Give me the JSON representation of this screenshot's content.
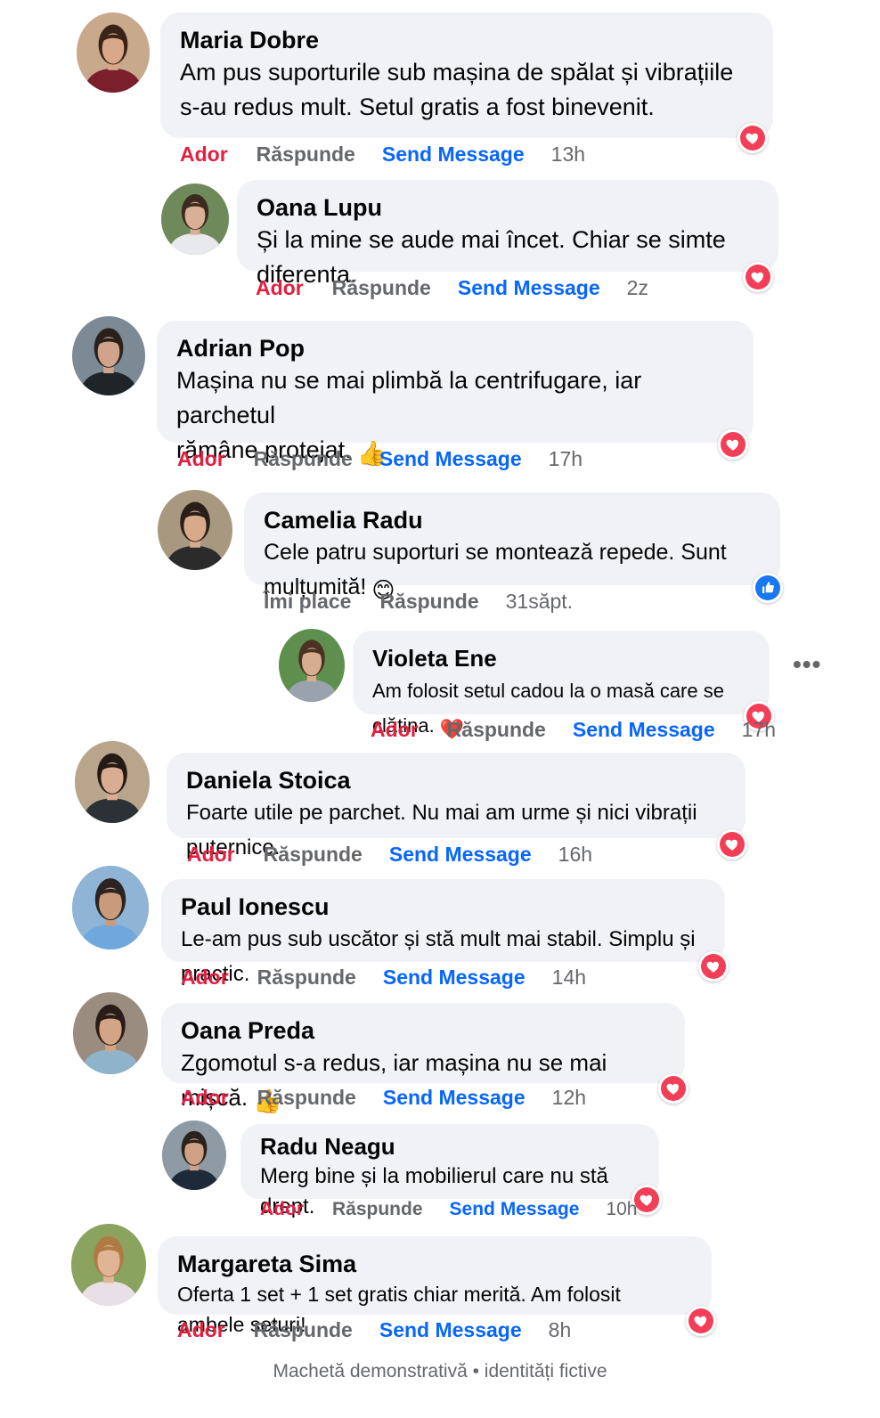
{
  "comments": [
    {
      "name": "Maria Dobre",
      "lines": [
        "Am pus suporturile sub mașina de spălat și vibrațiile",
        "s-au redus mult. Setul gratis a fost binevenit."
      ],
      "reaction_label": "Ador",
      "reply_label": "Răspunde",
      "send_label": "Send Message",
      "time": "13h",
      "reaction_icon": "love-icon",
      "avatar": {
        "bg": "#c9a98b",
        "skin": "#d9a88a",
        "hair": "#3a2418",
        "shirt": "#7a1f2b"
      }
    },
    {
      "name": "Oana Lupu",
      "lines": [
        "Și la mine se aude mai încet. Chiar se simte diferența."
      ],
      "reaction_label": "Ador",
      "reply_label": "Răspunde",
      "send_label": "Send Message",
      "time": "2z",
      "reaction_icon": "love-icon",
      "avatar": {
        "bg": "#6f8a5a",
        "skin": "#d8b095",
        "hair": "#3b2a1e",
        "shirt": "#e7e9ec"
      }
    },
    {
      "name": "Adrian Pop",
      "lines": [
        "Mașina nu se mai plimbă la centrifugare, iar parchetul",
        "rămâne protejat."
      ],
      "emoji": "👍",
      "reaction_label": "Ador",
      "reply_label": "Răspunde",
      "send_label": "Send Message",
      "time": "17h",
      "reaction_icon": "love-icon",
      "avatar": {
        "bg": "#7c8a95",
        "skin": "#cfa48a",
        "hair": "#2a211c",
        "shirt": "#1f2429"
      }
    },
    {
      "name": "Camelia Radu",
      "lines": [
        "Cele patru suporturi se montează repede. Sunt mulțumită!"
      ],
      "emoji": "😊",
      "reaction_label": "Îmi place",
      "reply_label": "Răspunde",
      "time": "31săpt.",
      "reaction_icon": "like-icon",
      "avatar": {
        "bg": "#a89880",
        "skin": "#d7aa8c",
        "hair": "#2a1e18",
        "shirt": "#2b2b2b"
      }
    },
    {
      "name": "Violeta Ene",
      "lines": [
        "Am folosit setul cadou la o masă care se clătina."
      ],
      "emoji": "❤️",
      "reaction_label": "Ador",
      "reply_label": "Răspunde",
      "send_label": "Send Message",
      "time": "17h",
      "reaction_icon": "love-icon",
      "avatar": {
        "bg": "#5f8f4e",
        "skin": "#d7ad92",
        "hair": "#4a3322",
        "shirt": "#9aa3ad"
      }
    },
    {
      "name": "Daniela Stoica",
      "lines": [
        "Foarte utile pe parchet. Nu mai am urme și nici vibrații puternice."
      ],
      "reaction_label": "Ador",
      "reply_label": "Răspunde",
      "send_label": "Send Message",
      "time": "16h",
      "reaction_icon": "love-icon",
      "avatar": {
        "bg": "#b9a58c",
        "skin": "#d9ad91",
        "hair": "#231a15",
        "shirt": "#2c3138"
      }
    },
    {
      "name": "Paul Ionescu",
      "lines": [
        "Le-am pus sub uscător și stă mult mai stabil. Simplu și practic."
      ],
      "reaction_label": "Ador",
      "reply_label": "Răspunde",
      "send_label": "Send Message",
      "time": "14h",
      "reaction_icon": "love-icon",
      "avatar": {
        "bg": "#8fb4d6",
        "skin": "#c99a7c",
        "hair": "#2b2420",
        "shirt": "#6fa8dc"
      }
    },
    {
      "name": "Oana Preda",
      "lines": [
        "Zgomotul s-a redus, iar mașina nu se mai mișcă."
      ],
      "emoji": "👍",
      "reaction_label": "Ador",
      "reply_label": "Răspunde",
      "send_label": "Send Message",
      "time": "12h",
      "reaction_icon": "love-icon",
      "avatar": {
        "bg": "#9a8c7e",
        "skin": "#d4a487",
        "hair": "#2a1d17",
        "shirt": "#8fb3c9"
      }
    },
    {
      "name": "Radu Neagu",
      "lines": [
        "Merg bine și la mobilierul care nu stă drept."
      ],
      "reaction_label": "Ador",
      "reply_label": "Răspunde",
      "send_label": "Send Message",
      "time": "10h",
      "reaction_icon": "love-icon",
      "avatar": {
        "bg": "#8e9aa4",
        "skin": "#cfa286",
        "hair": "#2a221d",
        "shirt": "#1e2a3a"
      }
    },
    {
      "name": "Margareta Sima",
      "lines": [
        "Oferta 1 set + 1 set gratis chiar merită. Am folosit ambele seturi!"
      ],
      "reaction_label": "Ador",
      "reply_label": "Răspunde",
      "send_label": "Send Message",
      "time": "8h",
      "reaction_icon": "love-icon",
      "avatar": {
        "bg": "#8aa35f",
        "skin": "#e0b595",
        "hair": "#b07a45",
        "shirt": "#e9dfe6"
      }
    }
  ],
  "more_icon": "more-horizontal-icon",
  "footer": "Machetă demonstrativă • identități fictive"
}
